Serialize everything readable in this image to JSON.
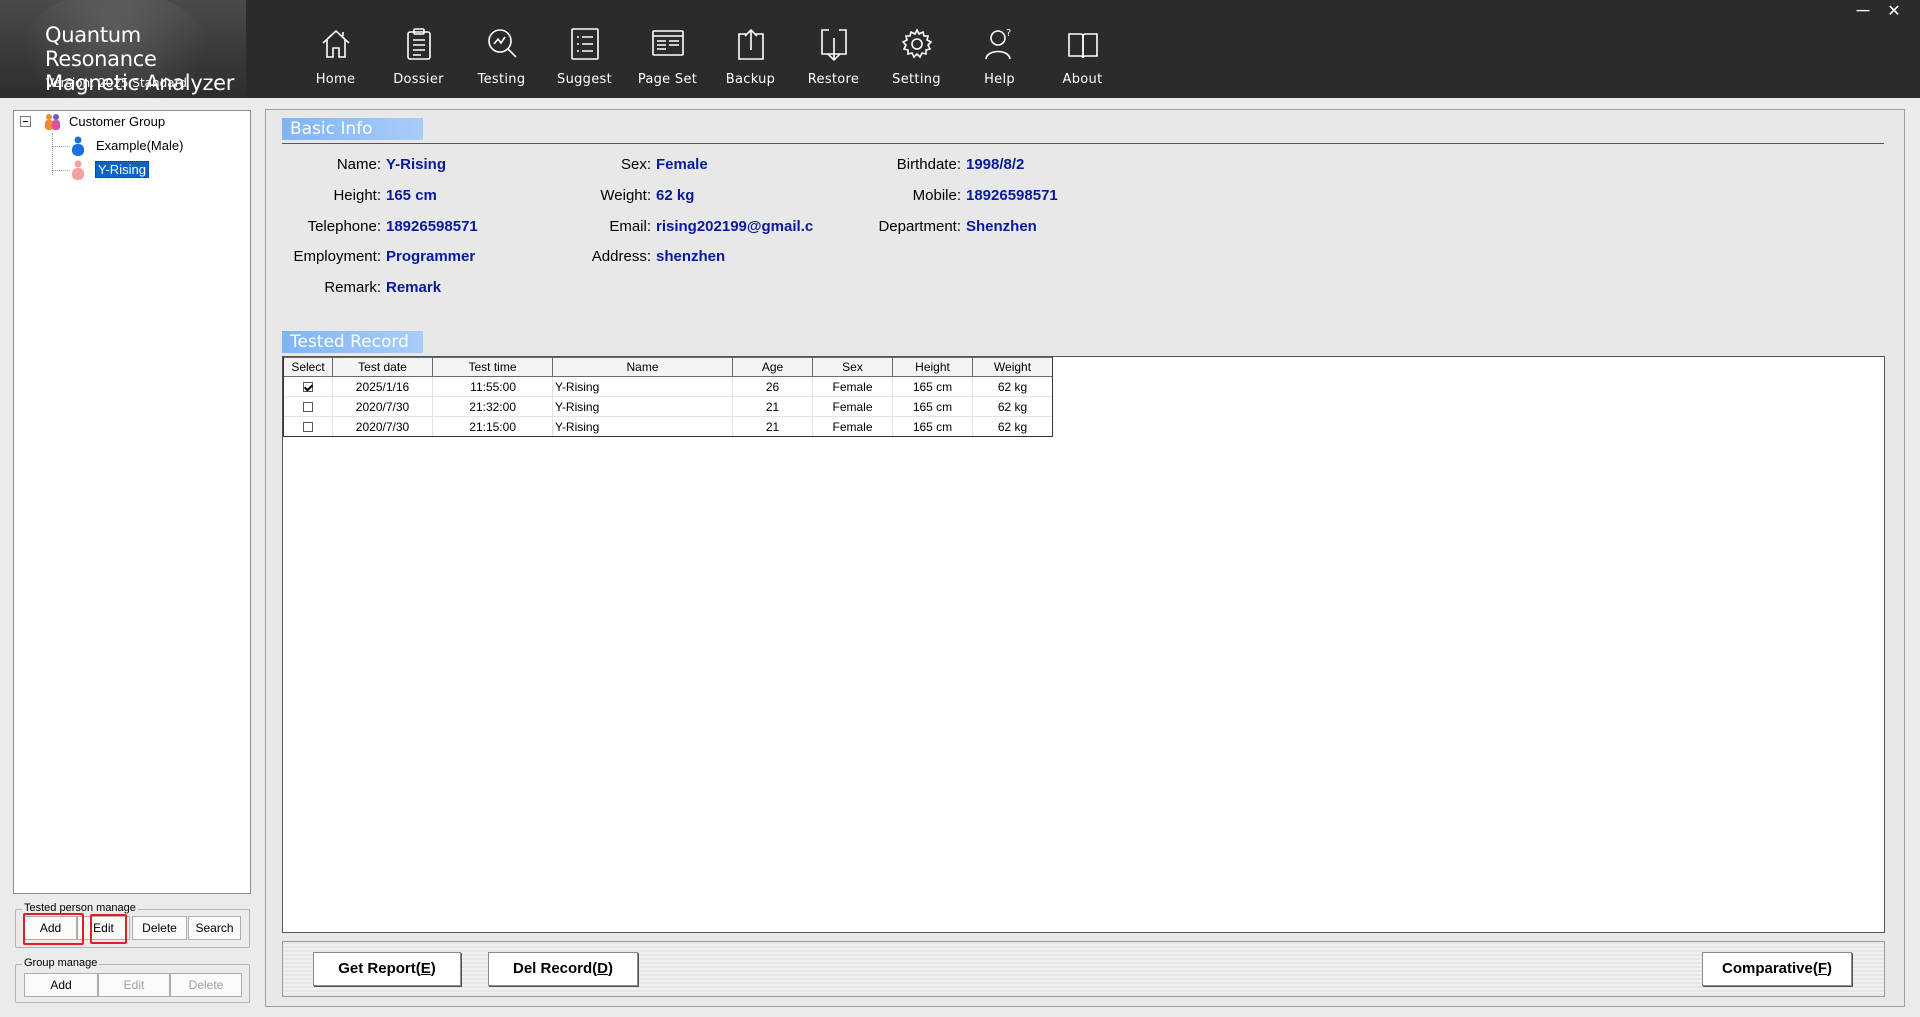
{
  "app": {
    "title_line1": "Quantum Resonance",
    "title_line2": "Magnetic Analyzer",
    "version": "Version: 2025 Standard"
  },
  "nav": [
    {
      "label": "Home",
      "icon": "home-icon"
    },
    {
      "label": "Dossier",
      "icon": "clipboard-icon"
    },
    {
      "label": "Testing",
      "icon": "magnifier-icon"
    },
    {
      "label": "Suggest",
      "icon": "list-icon"
    },
    {
      "label": "Page Set",
      "icon": "page-layout-icon"
    },
    {
      "label": "Backup",
      "icon": "upload-icon"
    },
    {
      "label": "Restore",
      "icon": "download-icon"
    },
    {
      "label": "Setting",
      "icon": "gear-icon"
    },
    {
      "label": "Help",
      "icon": "help-person-icon"
    },
    {
      "label": "About",
      "icon": "book-icon"
    }
  ],
  "window": {
    "minimize": "─",
    "close": "✕"
  },
  "tree": {
    "root": "Customer Group",
    "children": [
      "Example(Male)",
      "Y-Rising"
    ],
    "selected": "Y-Rising"
  },
  "tested_person_manage": {
    "title": "Tested person manage",
    "add": "Add",
    "edit": "Edit",
    "delete": "Delete",
    "search": "Search"
  },
  "group_manage": {
    "title": "Group manage",
    "add": "Add",
    "edit": "Edit",
    "delete": "Delete"
  },
  "basic_info": {
    "heading": "Basic Info",
    "fields": {
      "name": {
        "label": "Name:",
        "value": "Y-Rising"
      },
      "sex": {
        "label": "Sex:",
        "value": "Female"
      },
      "birthdate": {
        "label": "Birthdate:",
        "value": "1998/8/2"
      },
      "height": {
        "label": "Height:",
        "value": "165 cm"
      },
      "weight": {
        "label": "Weight:",
        "value": "62 kg"
      },
      "mobile": {
        "label": "Mobile:",
        "value": "18926598571"
      },
      "telephone": {
        "label": "Telephone:",
        "value": "18926598571"
      },
      "email": {
        "label": "Email:",
        "value": "rising202199@gmail.c"
      },
      "department": {
        "label": "Department:",
        "value": "Shenzhen"
      },
      "employment": {
        "label": "Employment:",
        "value": "Programmer"
      },
      "address": {
        "label": "Address:",
        "value": "shenzhen"
      },
      "remark": {
        "label": "Remark:",
        "value": "Remark"
      }
    }
  },
  "tested_record": {
    "heading": "Tested Record",
    "columns": [
      "Select",
      "Test date",
      "Test time",
      "Name",
      "Age",
      "Sex",
      "Height",
      "Weight"
    ],
    "rows": [
      {
        "selected": true,
        "date": "2025/1/16",
        "time": "11:55:00",
        "name": "Y-Rising",
        "age": "26",
        "sex": "Female",
        "height": "165 cm",
        "weight": "62 kg"
      },
      {
        "selected": false,
        "date": "2020/7/30",
        "time": "21:32:00",
        "name": "Y-Rising",
        "age": "21",
        "sex": "Female",
        "height": "165 cm",
        "weight": "62 kg"
      },
      {
        "selected": false,
        "date": "2020/7/30",
        "time": "21:15:00",
        "name": "Y-Rising",
        "age": "21",
        "sex": "Female",
        "height": "165 cm",
        "weight": "62 kg"
      }
    ]
  },
  "actions": {
    "get_report_prefix": "Get Report(",
    "get_report_key": "E",
    "del_record_prefix": "Del Record(",
    "del_record_key": "D",
    "comparative_prefix": "Comparative(",
    "comparative_key": "F",
    "close_paren": ")"
  },
  "colors": {
    "header_bg": "#2b2b2b",
    "accent_tag": "#7fb4f5",
    "value_text": "#0a1a9a",
    "selection": "#0a64c8",
    "highlight_frame": "#e02020"
  }
}
